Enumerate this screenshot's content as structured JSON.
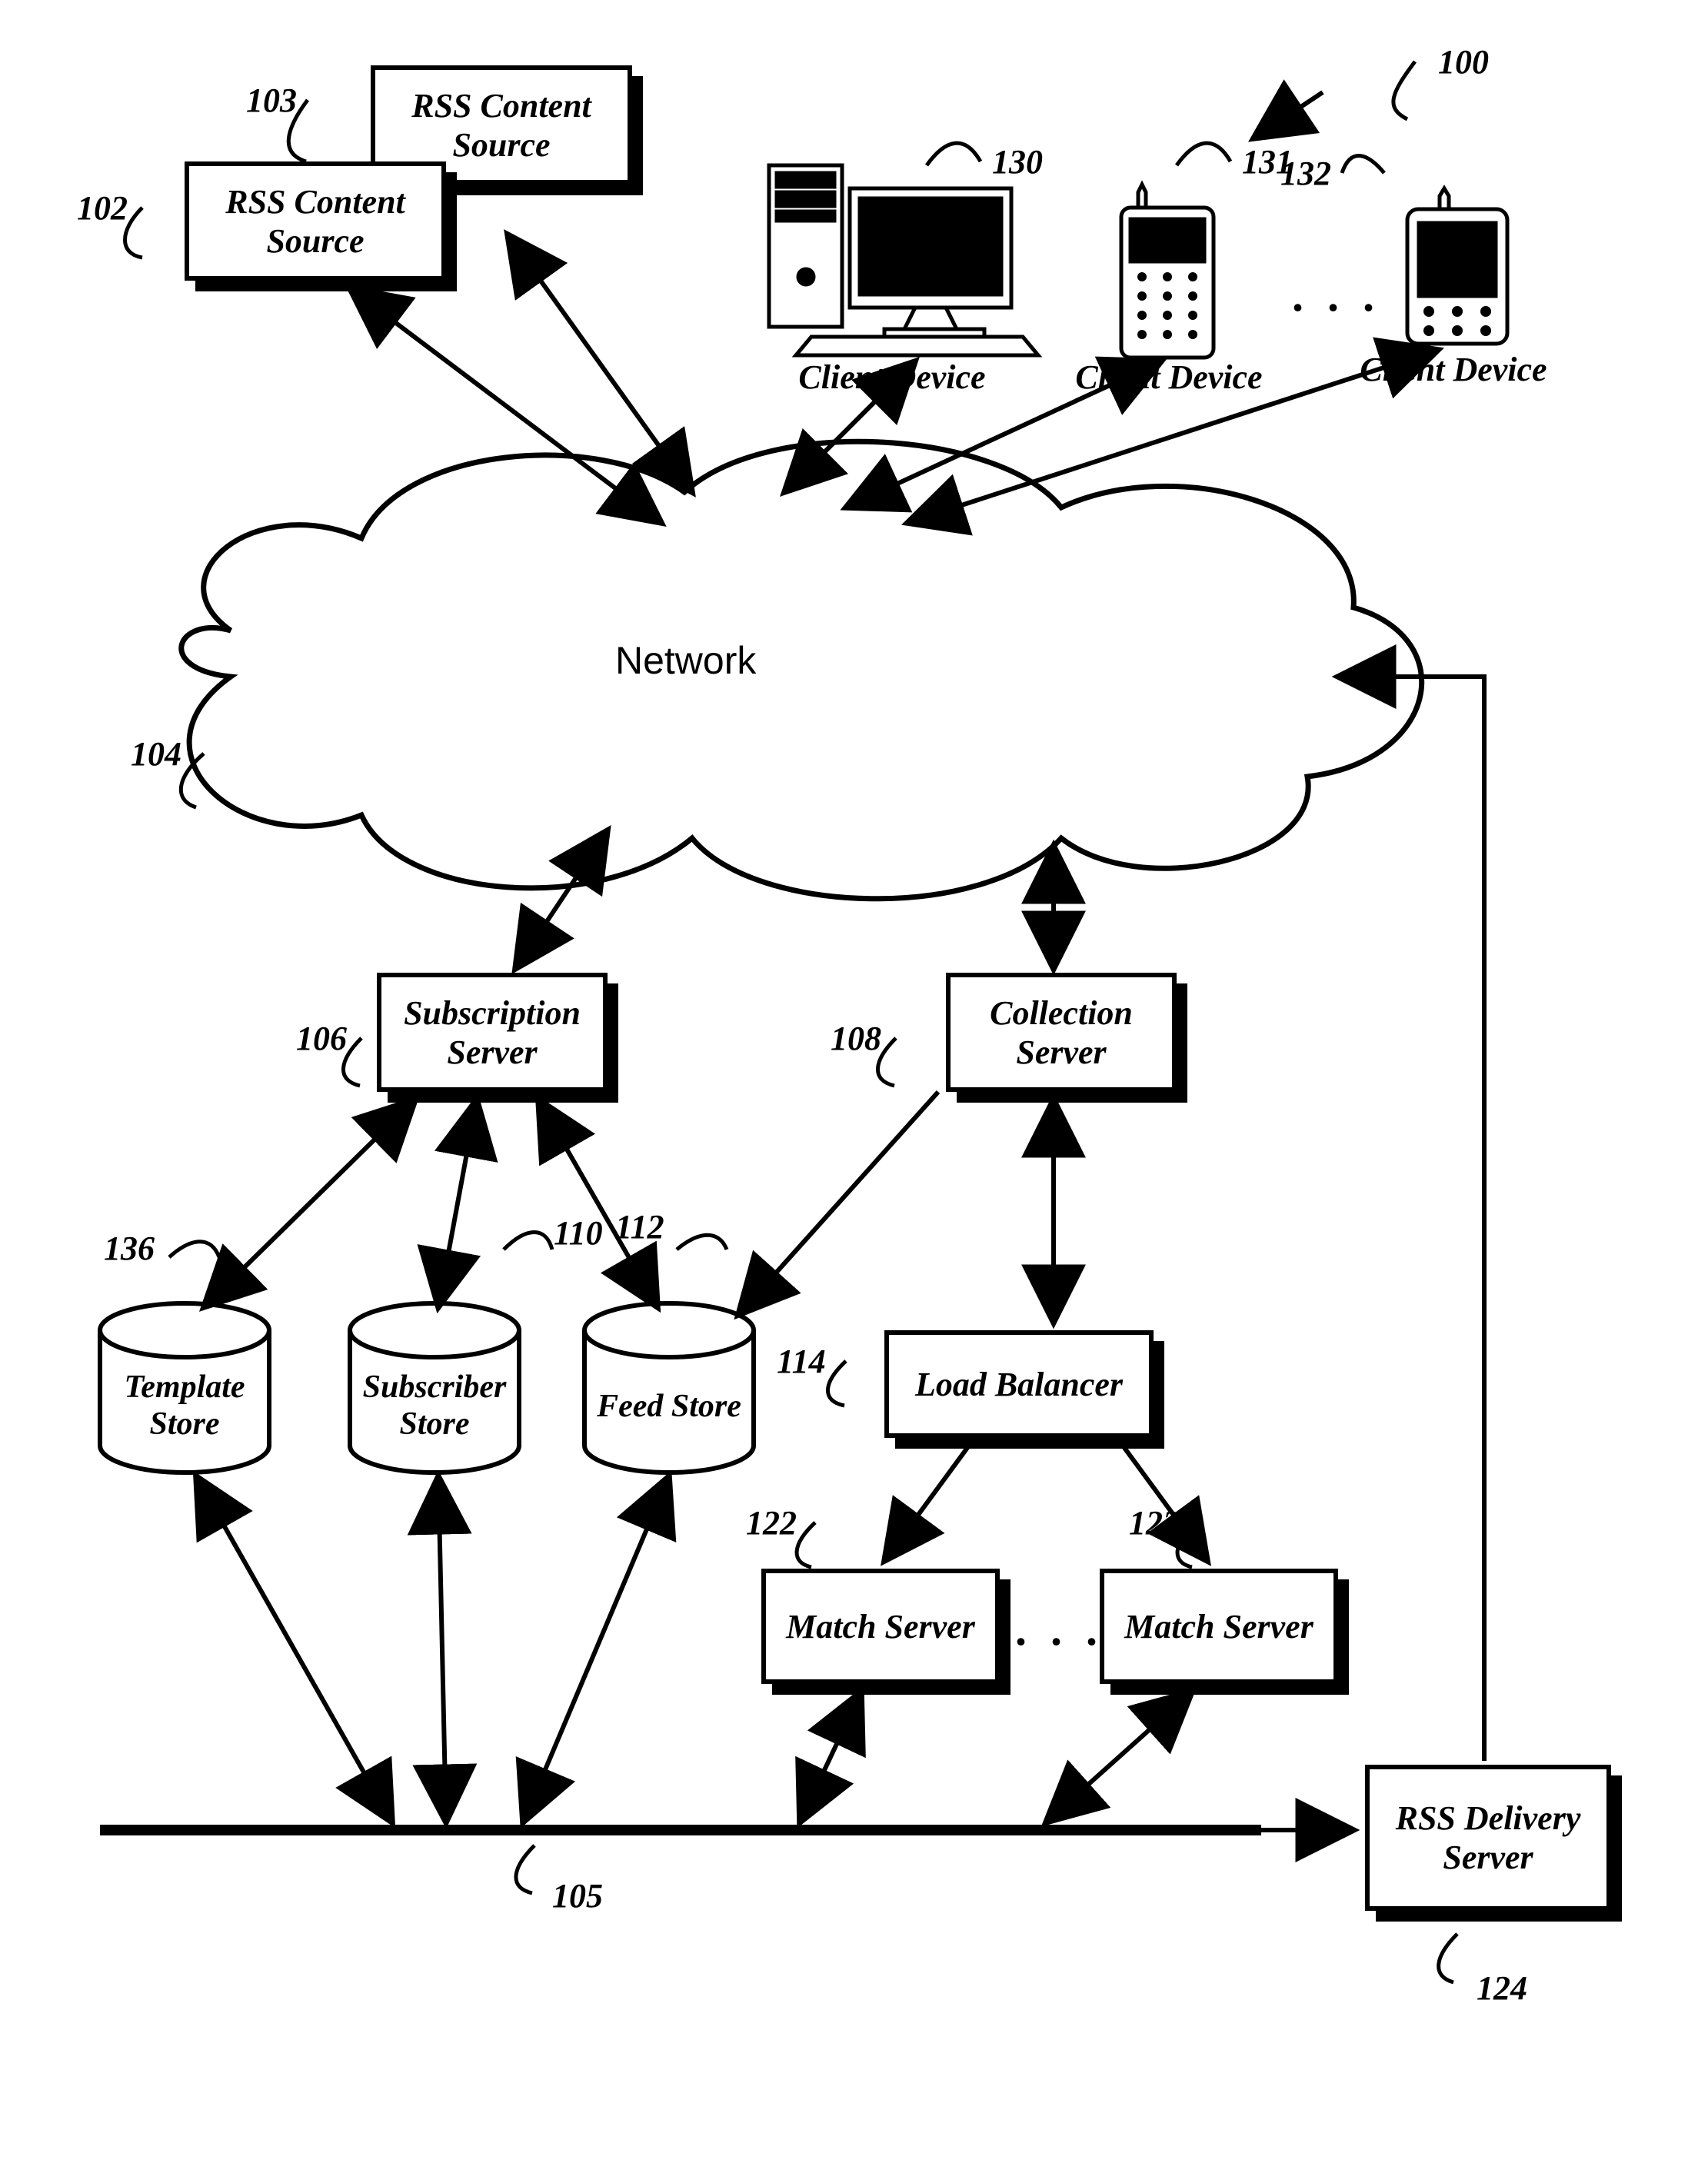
{
  "refs": {
    "r100": "100",
    "r102": "102",
    "r103": "103",
    "r104": "104",
    "r105": "105",
    "r106": "106",
    "r108": "108",
    "r110": "110",
    "r112": "112",
    "r114": "114",
    "r122": "122",
    "r123": "123",
    "r124": "124",
    "r130": "130",
    "r131": "131",
    "r132": "132",
    "r136": "136"
  },
  "labels": {
    "rss_source_1": "RSS Content Source",
    "rss_source_2": "RSS Content Source",
    "client_device": "Client Device",
    "network": "Network",
    "subscription_server": "Subscription Server",
    "collection_server": "Collection Server",
    "template_store": "Template Store",
    "subscriber_store": "Subscriber Store",
    "feed_store": "Feed Store",
    "load_balancer": "Load Balancer",
    "match_server": "Match Server",
    "rss_delivery_server": "RSS Delivery Server",
    "ellipsis": ". . ."
  }
}
